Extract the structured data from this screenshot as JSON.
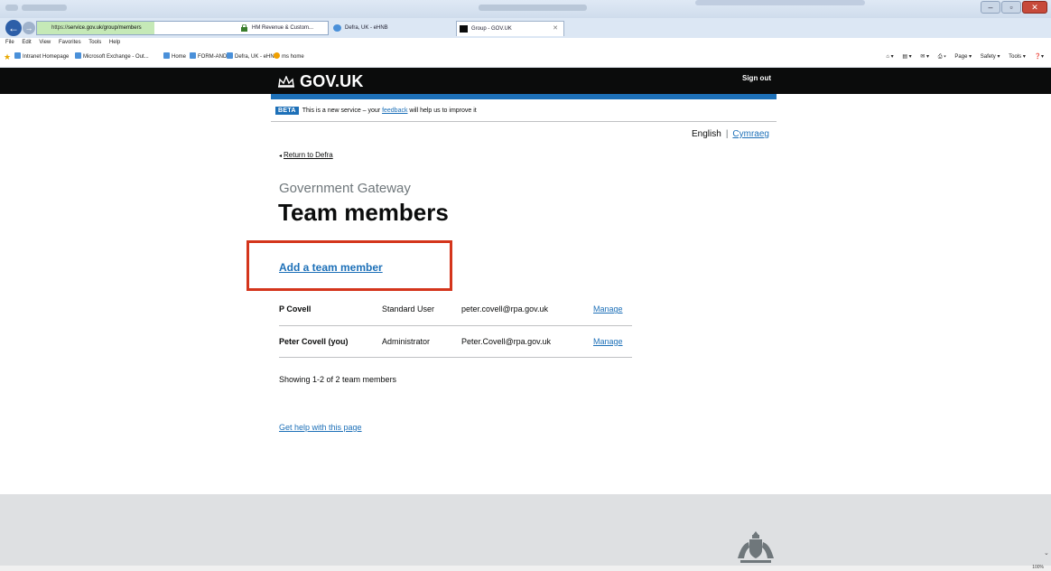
{
  "browser": {
    "address_url_prefix": "https://",
    "address_url_domain": "service.gov.uk",
    "address_url_suffix": "/group/members",
    "tabs": [
      {
        "label": "HM Revenue & Custom..."
      },
      {
        "label": "Defra, UK - eHNB"
      },
      {
        "label": "Group - GOV.UK"
      }
    ],
    "menu": [
      "File",
      "Edit",
      "View",
      "Favorites",
      "Tools",
      "Help"
    ],
    "favorites": [
      {
        "label": "Intranet Homepage"
      },
      {
        "label": "Microsoft Exchange - Out..."
      },
      {
        "label": "Home"
      },
      {
        "label": "FORM-AND"
      },
      {
        "label": "Defra, UK - eHNB"
      },
      {
        "label": "ms home"
      }
    ],
    "command_bar": [
      "Page ▾",
      "Safety ▾",
      "Tools ▾"
    ],
    "zoom": "100%"
  },
  "header": {
    "logo": "GOV.UK",
    "sign_out": "Sign out",
    "brand_color": "#0b0c0c",
    "accent_color": "#1d70b8"
  },
  "beta_banner": {
    "tag": "BETA",
    "text_before": "This is a new service – your ",
    "feedback_link": "feedback",
    "text_after": " will help us to improve it"
  },
  "language": {
    "english": "English",
    "separator": "|",
    "welsh": "Cymraeg"
  },
  "back_link": "Return to Defra",
  "page": {
    "caption": "Government Gateway",
    "title": "Team members",
    "add_member": "Add a team member",
    "showing": "Showing 1-2 of 2 team members",
    "help_link": "Get help with this page"
  },
  "members": [
    {
      "name": "P Covell",
      "role": "Standard User",
      "email": "peter.covell@rpa.gov.uk",
      "action": "Manage"
    },
    {
      "name": "Peter Covell (you)",
      "role": "Administrator",
      "email": "Peter.Covell@rpa.gov.uk",
      "action": "Manage"
    }
  ],
  "highlight_color": "#d4351c"
}
